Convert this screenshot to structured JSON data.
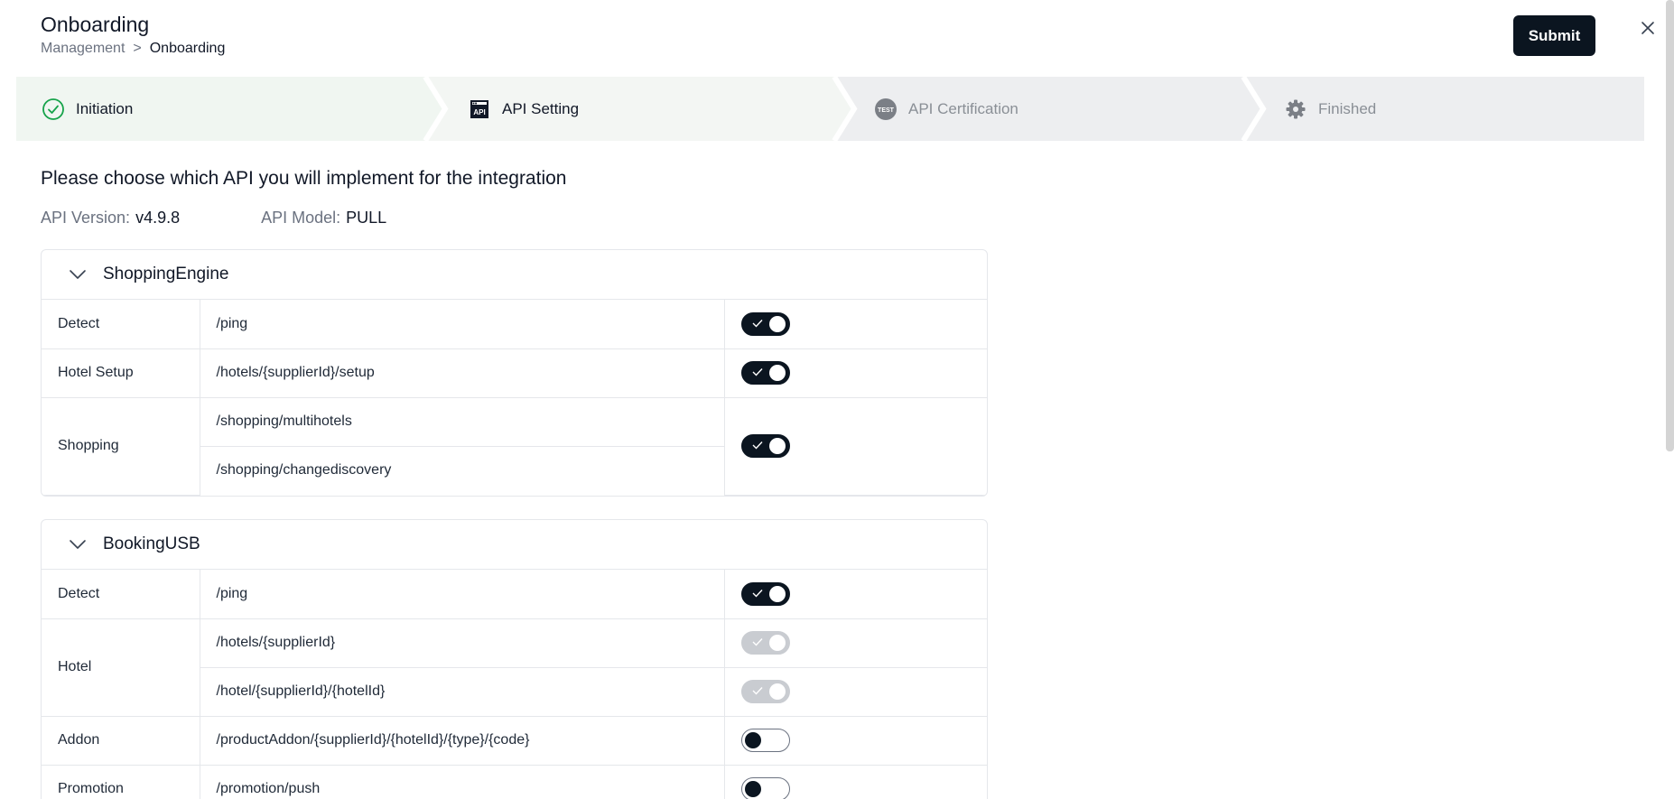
{
  "header": {
    "title": "Onboarding",
    "breadcrumb": {
      "parent": "Management",
      "separator": ">",
      "current": "Onboarding"
    },
    "submit_label": "Submit",
    "close_icon": "close-icon"
  },
  "steps": [
    {
      "label": "Initiation",
      "icon": "check-circle-icon",
      "state": "done"
    },
    {
      "label": "API Setting",
      "icon": "api-icon",
      "state": "active"
    },
    {
      "label": "API Certification",
      "icon": "test-badge-icon",
      "state": "pending"
    },
    {
      "label": "Finished",
      "icon": "gear-icon",
      "state": "pending"
    }
  ],
  "intro": {
    "question": "Please choose which API you will implement for the integration",
    "api_version_label": "API Version:",
    "api_version": "v4.9.8",
    "api_model_label": "API Model:",
    "api_model": "PULL"
  },
  "panels": [
    {
      "name": "ShoppingEngine",
      "rows": [
        {
          "category": "Detect",
          "paths": [
            "/ping"
          ],
          "toggle": "on"
        },
        {
          "category": "Hotel Setup",
          "paths": [
            "/hotels/{supplierId}/setup"
          ],
          "toggle": "on"
        },
        {
          "category": "Shopping",
          "paths": [
            "/shopping/multihotels",
            "/shopping/changediscovery"
          ],
          "toggle": "on"
        }
      ]
    },
    {
      "name": "BookingUSB",
      "rows": [
        {
          "category": "Detect",
          "paths": [
            "/ping"
          ],
          "toggle": "on"
        },
        {
          "category": "Hotel",
          "paths": [
            "/hotels/{supplierId}"
          ],
          "toggle": "on-disabled"
        },
        {
          "category": "",
          "paths": [
            "/hotel/{supplierId}/{hotelId}"
          ],
          "toggle": "on-disabled"
        },
        {
          "category": "Addon",
          "paths": [
            "/productAddon/{supplierId}/{hotelId}/{type}/{code}"
          ],
          "toggle": "off"
        },
        {
          "category": "Promotion",
          "paths": [
            "/promotion/push"
          ],
          "toggle": "off"
        }
      ]
    }
  ],
  "colors": {
    "primary": "#0b1520",
    "done_green": "#16a34a",
    "done_bg": "#f0f6f1",
    "pending_bg": "#edeef0"
  }
}
